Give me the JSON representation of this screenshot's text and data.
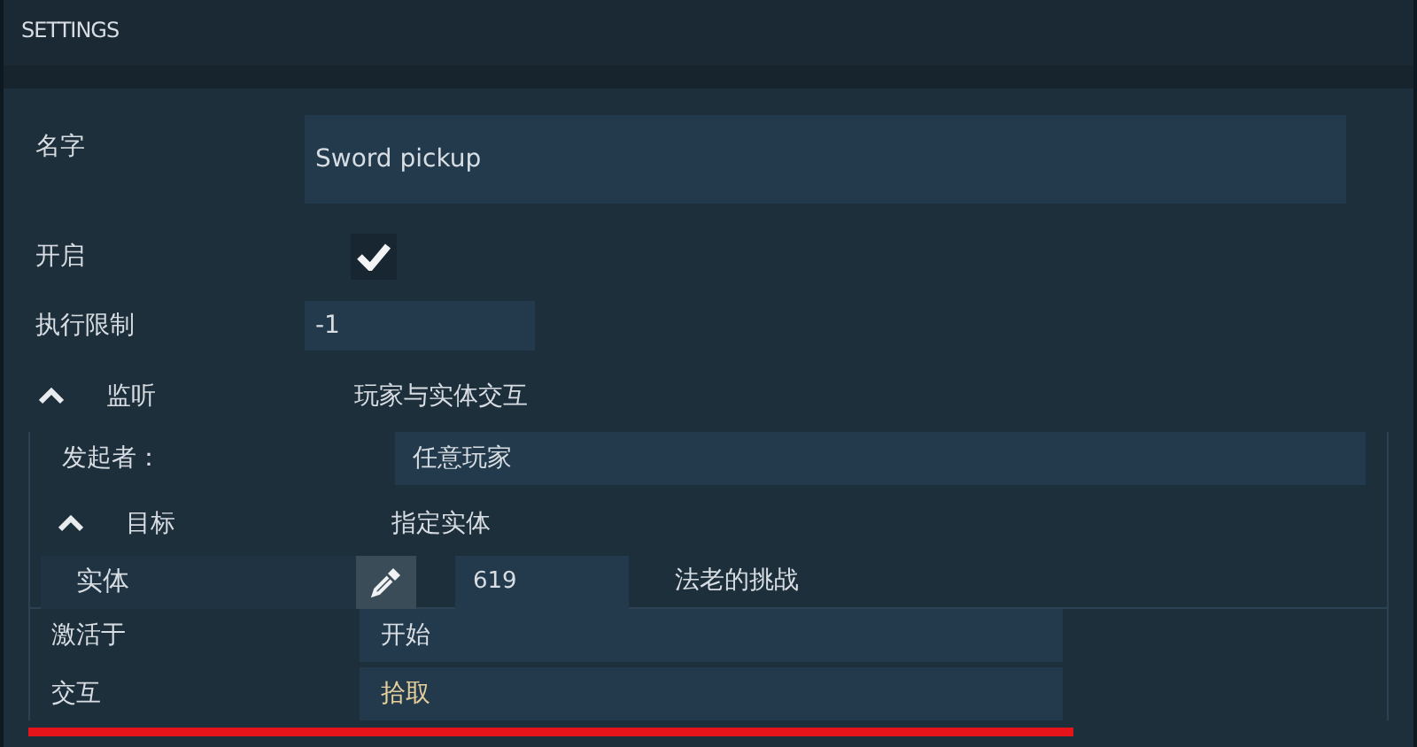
{
  "panel": {
    "title": "SETTINGS"
  },
  "name": {
    "label": "名字",
    "value": "Sword pickup"
  },
  "enabled": {
    "label": "开启",
    "checked": true
  },
  "limit": {
    "label": "执行限制",
    "value": "-1"
  },
  "listener": {
    "label": "监听",
    "expanded": true,
    "value": "玩家与实体交互",
    "initiator": {
      "label": "发起者：",
      "value": "任意玩家"
    },
    "target": {
      "label": "目标",
      "expanded": true,
      "value": "指定实体",
      "entity": {
        "label": "实体",
        "id": "619",
        "entity_name": "法老的挑战"
      }
    },
    "activate": {
      "label": "激活于",
      "value": "开始"
    },
    "interaction": {
      "label": "交互",
      "value": "拾取"
    }
  }
}
